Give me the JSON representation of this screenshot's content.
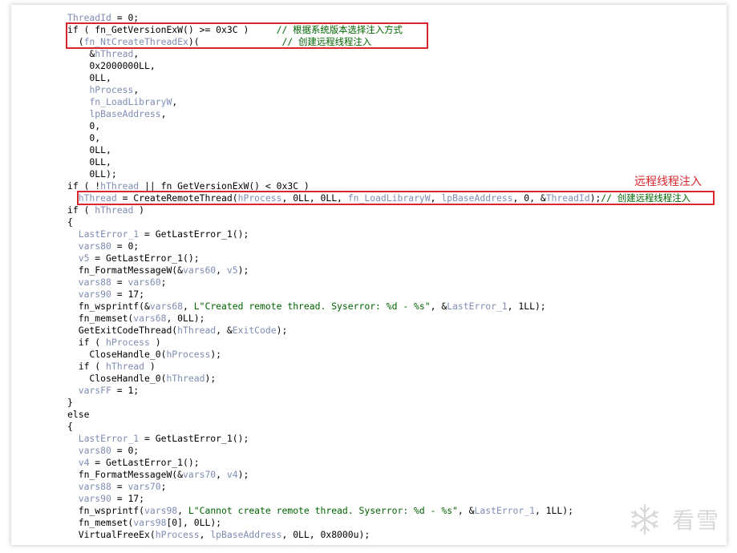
{
  "annotation": {
    "label": "远程线程注入"
  },
  "watermark": {
    "text": "看雪"
  },
  "code_lines": [
    [
      [
        "v",
        "ThreadId"
      ],
      [
        "p",
        " = 0;"
      ]
    ],
    [
      [
        "p",
        "if ( fn_GetVersionExW() >= 0x3C )     "
      ],
      [
        "c",
        "// 根据系统版本选择注入方式"
      ]
    ],
    [
      [
        "p",
        "  ("
      ],
      [
        "v",
        "fn_NtCreateThreadEx"
      ],
      [
        "p",
        ")(               "
      ],
      [
        "c",
        "// 创建远程线程注入"
      ]
    ],
    [
      [
        "p",
        "    &"
      ],
      [
        "v",
        "hThread"
      ],
      [
        "p",
        ","
      ]
    ],
    [
      [
        "p",
        "    0x2000000LL,"
      ]
    ],
    [
      [
        "p",
        "    0LL,"
      ]
    ],
    [
      [
        "p",
        "    "
      ],
      [
        "v",
        "hProcess"
      ],
      [
        "p",
        ","
      ]
    ],
    [
      [
        "p",
        "    "
      ],
      [
        "v",
        "fn_LoadLibraryW"
      ],
      [
        "p",
        ","
      ]
    ],
    [
      [
        "p",
        "    "
      ],
      [
        "v",
        "lpBaseAddress"
      ],
      [
        "p",
        ","
      ]
    ],
    [
      [
        "p",
        "    0,"
      ]
    ],
    [
      [
        "p",
        "    0,"
      ]
    ],
    [
      [
        "p",
        "    0LL,"
      ]
    ],
    [
      [
        "p",
        "    0LL,"
      ]
    ],
    [
      [
        "p",
        "    0LL);"
      ]
    ],
    [
      [
        "p",
        "if ( !"
      ],
      [
        "v",
        "hThread"
      ],
      [
        "p",
        " || fn_GetVersionExW() < 0x3C )"
      ]
    ],
    [
      [
        "p",
        "  "
      ],
      [
        "v",
        "hThread"
      ],
      [
        "p",
        " = CreateRemoteThread("
      ],
      [
        "v",
        "hProcess"
      ],
      [
        "p",
        ", 0LL, 0LL, "
      ],
      [
        "v",
        "fn_LoadLibraryW"
      ],
      [
        "p",
        ", "
      ],
      [
        "v",
        "lpBaseAddress"
      ],
      [
        "p",
        ", 0, &"
      ],
      [
        "v",
        "ThreadId"
      ],
      [
        "p",
        ");"
      ],
      [
        "c",
        "// 创建远程线程注入"
      ]
    ],
    [
      [
        "p",
        "if ( "
      ],
      [
        "v",
        "hThread"
      ],
      [
        "p",
        " )"
      ]
    ],
    [
      [
        "p",
        "{"
      ]
    ],
    [
      [
        "p",
        "  "
      ],
      [
        "v",
        "LastError_1"
      ],
      [
        "p",
        " = GetLastError_1();"
      ]
    ],
    [
      [
        "p",
        "  "
      ],
      [
        "v",
        "vars80"
      ],
      [
        "p",
        " = 0;"
      ]
    ],
    [
      [
        "p",
        "  "
      ],
      [
        "v",
        "v5"
      ],
      [
        "p",
        " = GetLastError_1();"
      ]
    ],
    [
      [
        "p",
        "  fn_FormatMessageW(&"
      ],
      [
        "v",
        "vars60"
      ],
      [
        "p",
        ", "
      ],
      [
        "v",
        "v5"
      ],
      [
        "p",
        ");"
      ]
    ],
    [
      [
        "p",
        "  "
      ],
      [
        "v",
        "vars88"
      ],
      [
        "p",
        " = "
      ],
      [
        "v",
        "vars60"
      ],
      [
        "p",
        ";"
      ]
    ],
    [
      [
        "p",
        "  "
      ],
      [
        "v",
        "vars90"
      ],
      [
        "p",
        " = 17;"
      ]
    ],
    [
      [
        "p",
        "  fn_wsprintf(&"
      ],
      [
        "v",
        "vars68"
      ],
      [
        "p",
        ", "
      ],
      [
        "s",
        "L\"Created remote thread. Syserror: %d - %s\""
      ],
      [
        "p",
        ", &"
      ],
      [
        "v",
        "LastError_1"
      ],
      [
        "p",
        ", 1LL);"
      ]
    ],
    [
      [
        "p",
        "  fn_memset("
      ],
      [
        "v",
        "vars68"
      ],
      [
        "p",
        ", 0LL);"
      ]
    ],
    [
      [
        "p",
        "  GetExitCodeThread("
      ],
      [
        "v",
        "hThread"
      ],
      [
        "p",
        ", &"
      ],
      [
        "v",
        "ExitCode"
      ],
      [
        "p",
        ");"
      ]
    ],
    [
      [
        "p",
        "  if ( "
      ],
      [
        "v",
        "hProcess"
      ],
      [
        "p",
        " )"
      ]
    ],
    [
      [
        "p",
        "    CloseHandle_0("
      ],
      [
        "v",
        "hProcess"
      ],
      [
        "p",
        ");"
      ]
    ],
    [
      [
        "p",
        "  if ( "
      ],
      [
        "v",
        "hThread"
      ],
      [
        "p",
        " )"
      ]
    ],
    [
      [
        "p",
        "    CloseHandle_0("
      ],
      [
        "v",
        "hThread"
      ],
      [
        "p",
        ");"
      ]
    ],
    [
      [
        "p",
        "  "
      ],
      [
        "v",
        "varsFF"
      ],
      [
        "p",
        " = 1;"
      ]
    ],
    [
      [
        "p",
        "}"
      ]
    ],
    [
      [
        "p",
        "else"
      ]
    ],
    [
      [
        "p",
        "{"
      ]
    ],
    [
      [
        "p",
        "  "
      ],
      [
        "v",
        "LastError_1"
      ],
      [
        "p",
        " = GetLastError_1();"
      ]
    ],
    [
      [
        "p",
        "  "
      ],
      [
        "v",
        "vars80"
      ],
      [
        "p",
        " = 0;"
      ]
    ],
    [
      [
        "p",
        "  "
      ],
      [
        "v",
        "v4"
      ],
      [
        "p",
        " = GetLastError_1();"
      ]
    ],
    [
      [
        "p",
        "  fn_FormatMessageW(&"
      ],
      [
        "v",
        "vars70"
      ],
      [
        "p",
        ", "
      ],
      [
        "v",
        "v4"
      ],
      [
        "p",
        ");"
      ]
    ],
    [
      [
        "p",
        "  "
      ],
      [
        "v",
        "vars88"
      ],
      [
        "p",
        " = "
      ],
      [
        "v",
        "vars70"
      ],
      [
        "p",
        ";"
      ]
    ],
    [
      [
        "p",
        "  "
      ],
      [
        "v",
        "vars90"
      ],
      [
        "p",
        " = 17;"
      ]
    ],
    [
      [
        "p",
        "  fn_wsprintf("
      ],
      [
        "v",
        "vars98"
      ],
      [
        "p",
        ", "
      ],
      [
        "s",
        "L\"Cannot create remote thread. Syserror: %d - %s\""
      ],
      [
        "p",
        ", &"
      ],
      [
        "v",
        "LastError_1"
      ],
      [
        "p",
        ", 1LL);"
      ]
    ],
    [
      [
        "p",
        "  fn_memset("
      ],
      [
        "v",
        "vars98"
      ],
      [
        "p",
        "[0], 0LL);"
      ]
    ],
    [
      [
        "p",
        "  VirtualFreeEx("
      ],
      [
        "v",
        "hProcess"
      ],
      [
        "p",
        ", "
      ],
      [
        "v",
        "lpBaseAddress"
      ],
      [
        "p",
        ", 0LL, 0x8000u);"
      ]
    ]
  ]
}
